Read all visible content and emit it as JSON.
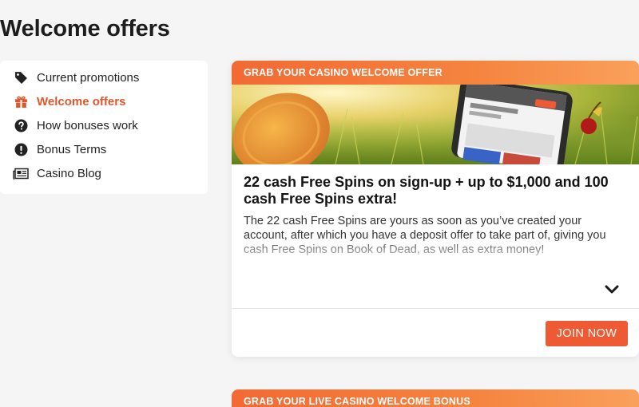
{
  "page": {
    "title": "Welcome offers"
  },
  "sidebar": {
    "items": [
      {
        "label": "Current promotions",
        "icon": "tag-icon",
        "active": false
      },
      {
        "label": "Welcome offers",
        "icon": "gift-icon",
        "active": true
      },
      {
        "label": "How bonuses work",
        "icon": "question-circle-icon",
        "active": false
      },
      {
        "label": "Bonus Terms",
        "icon": "exclamation-circle-icon",
        "active": false
      },
      {
        "label": "Casino Blog",
        "icon": "newspaper-icon",
        "active": false
      }
    ]
  },
  "colors": {
    "accent": "#e0562c",
    "button": "#ee5a33",
    "header_start": "#f26a34",
    "header_end": "#f9a15c"
  },
  "offers": [
    {
      "header": "GRAB YOUR CASINO WELCOME OFFER",
      "title": "22 cash Free Spins on sign-up + up to $1,000 and 100 cash Free Spins extra!",
      "description": "The 22 cash Free Spins are yours as soon as you’ve created your account, after which you have a deposit offer to take part of, giving you cash Free Spins on Book of Dead, as well as extra money!",
      "cta": "JOIN NOW"
    },
    {
      "header": "GRAB YOUR LIVE CASINO WELCOME BONUS"
    }
  ]
}
